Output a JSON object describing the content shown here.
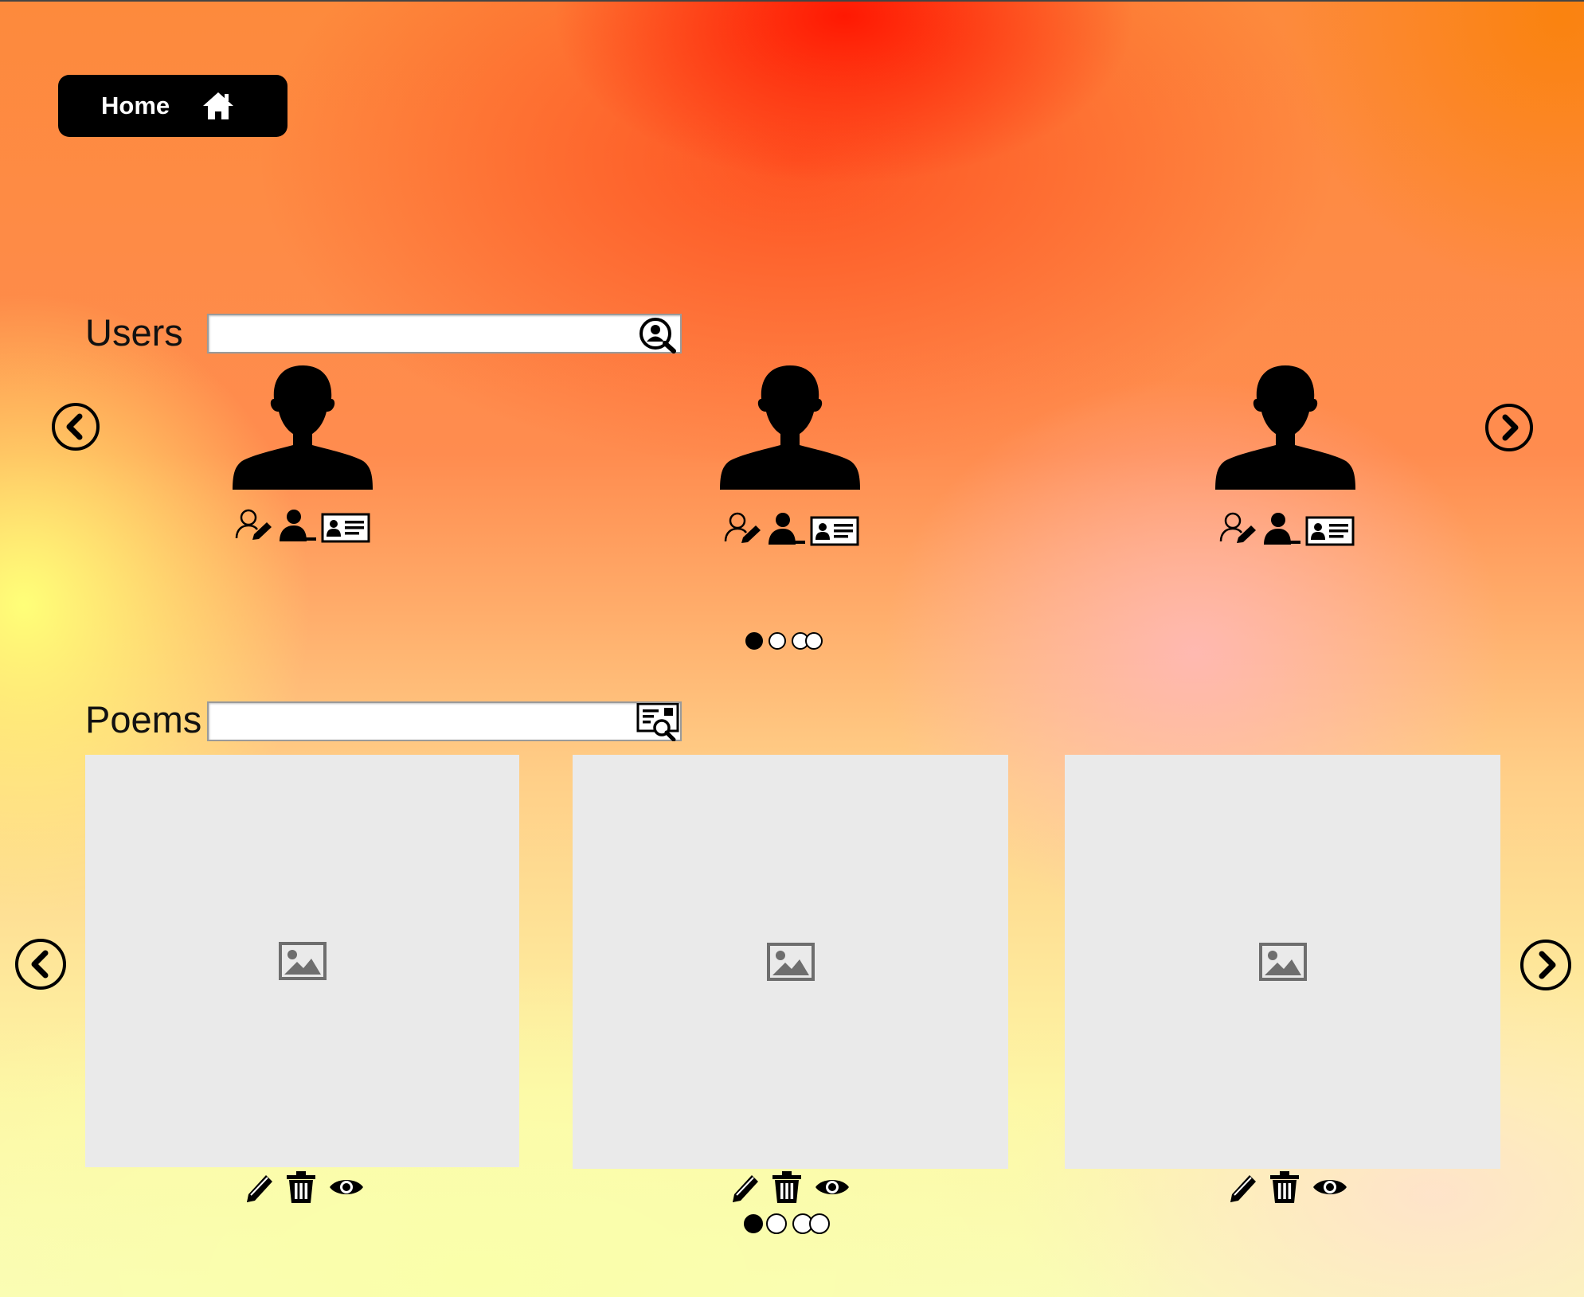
{
  "header": {
    "home_label": "Home",
    "home_icon": "home-icon"
  },
  "users": {
    "label": "Users",
    "search": {
      "value": "",
      "placeholder": "",
      "icon": "user-search-icon"
    },
    "cards": [
      {
        "icon": "user-silhouette-icon",
        "actions": [
          "edit-user-icon",
          "remove-user-icon",
          "user-card-icon"
        ]
      },
      {
        "icon": "user-silhouette-icon",
        "actions": [
          "edit-user-icon",
          "remove-user-icon",
          "user-card-icon"
        ]
      },
      {
        "icon": "user-silhouette-icon",
        "actions": [
          "edit-user-icon",
          "remove-user-icon",
          "user-card-icon"
        ]
      }
    ],
    "pagination": {
      "pages": 4,
      "current": 1
    }
  },
  "poems": {
    "label": "Poems",
    "search": {
      "value": "",
      "placeholder": "",
      "icon": "document-search-icon"
    },
    "cards": [
      {
        "icon": "image-placeholder-icon",
        "actions": [
          "edit-pencil-icon",
          "delete-trash-icon",
          "view-eye-icon"
        ]
      },
      {
        "icon": "image-placeholder-icon",
        "actions": [
          "edit-pencil-icon",
          "delete-trash-icon",
          "view-eye-icon"
        ]
      },
      {
        "icon": "image-placeholder-icon",
        "actions": [
          "edit-pencil-icon",
          "delete-trash-icon",
          "view-eye-icon"
        ]
      }
    ],
    "pagination": {
      "pages": 4,
      "current": 1
    }
  },
  "colors": {
    "button_bg": "#000000",
    "card_bg": "#eaeaea",
    "icon": "#000000",
    "placeholder_icon": "#6e6e6e"
  }
}
